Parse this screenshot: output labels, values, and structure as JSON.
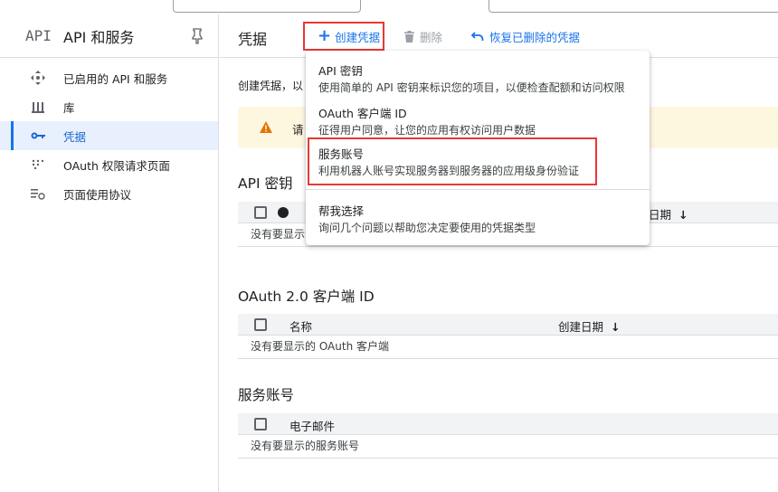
{
  "sidebar": {
    "logo": "API",
    "title": "API 和服务",
    "items": [
      {
        "label": "已启用的 API 和服务",
        "icon": "enabled-apis-icon"
      },
      {
        "label": "库",
        "icon": "library-icon"
      },
      {
        "label": "凭据",
        "icon": "key-icon",
        "active": true
      },
      {
        "label": "OAuth 权限请求页面",
        "icon": "oauth-consent-icon"
      },
      {
        "label": "页面使用协议",
        "icon": "page-agreement-icon"
      }
    ]
  },
  "toolbar": {
    "title": "凭据",
    "create_label": "创建凭据",
    "delete_label": "删除",
    "restore_label": "恢复已删除的凭据"
  },
  "main": {
    "description": "创建凭据，以",
    "warning_text": "请"
  },
  "api_keys": {
    "title": "API 密钥",
    "date_col": "日期",
    "empty": "没有要显示"
  },
  "oauth": {
    "title": "OAuth 2.0 客户端 ID",
    "name_col": "名称",
    "date_col": "创建日期",
    "empty": "没有要显示的 OAuth 客户端"
  },
  "service_accounts": {
    "title": "服务账号",
    "email_col": "电子邮件",
    "empty": "没有要显示的服务账号"
  },
  "dropdown": {
    "items": [
      {
        "title": "API 密钥",
        "subtitle": "使用简单的 API 密钥来标识您的项目，以便检查配额和访问权限"
      },
      {
        "title": "OAuth 客户端 ID",
        "subtitle": "征得用户同意，让您的应用有权访问用户数据"
      },
      {
        "title": "服务账号",
        "subtitle": "利用机器人账号实现服务器到服务器的应用级身份验证"
      },
      {
        "title": "帮我选择",
        "subtitle": "询问几个问题以帮助您决定要使用的凭据类型"
      }
    ]
  },
  "colors": {
    "accent": "#1a73e8",
    "highlight_border": "#e53935",
    "warning_bg": "#fef7e0",
    "warning_icon": "#e37400"
  }
}
